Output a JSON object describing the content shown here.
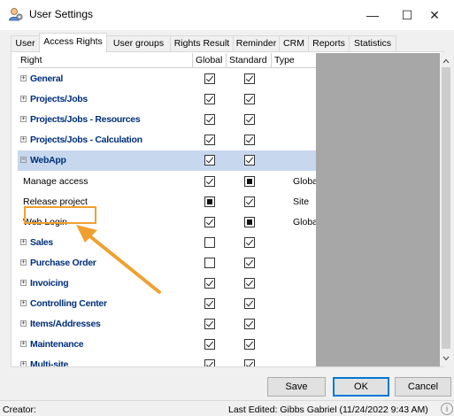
{
  "window": {
    "title": "User Settings",
    "minimize": "—",
    "maximize": "☐",
    "close": "✕"
  },
  "tabs": [
    {
      "label": "User"
    },
    {
      "label": "Access Rights",
      "active": true
    },
    {
      "label": "User groups"
    },
    {
      "label": "Rights Result"
    },
    {
      "label": "Reminder"
    },
    {
      "label": "CRM"
    },
    {
      "label": "Reports"
    },
    {
      "label": "Statistics"
    }
  ],
  "grid": {
    "columns": {
      "right": "Right",
      "global": "Global",
      "standard": "Standard",
      "type": "Type"
    },
    "rows": [
      {
        "label": "General",
        "kind": "group",
        "expander": "+",
        "global": "checked",
        "standard": "checked",
        "type": ""
      },
      {
        "label": "Projects/Jobs",
        "kind": "group",
        "expander": "+",
        "global": "checked",
        "standard": "checked",
        "type": ""
      },
      {
        "label": "Projects/Jobs - Resources",
        "kind": "group",
        "expander": "+",
        "global": "checked",
        "standard": "checked",
        "type": ""
      },
      {
        "label": "Projects/Jobs - Calculation",
        "kind": "group",
        "expander": "+",
        "global": "checked",
        "standard": "checked",
        "type": ""
      },
      {
        "label": "WebApp",
        "kind": "group",
        "expander": "−",
        "selected": true,
        "global": "checked",
        "standard": "checked",
        "type": ""
      },
      {
        "label": "Manage access",
        "kind": "child",
        "global": "checked",
        "standard": "indeterminate",
        "type": "Global"
      },
      {
        "label": "Release project",
        "kind": "child",
        "global": "indeterminate",
        "standard": "checked",
        "type": "Site"
      },
      {
        "label": "Web Login",
        "kind": "child",
        "global": "checked",
        "standard": "indeterminate",
        "type": "Global"
      },
      {
        "label": "Sales",
        "kind": "group",
        "expander": "+",
        "global": "unchecked",
        "standard": "checked",
        "type": ""
      },
      {
        "label": "Purchase Order",
        "kind": "group",
        "expander": "+",
        "global": "unchecked",
        "standard": "checked",
        "type": ""
      },
      {
        "label": "Invoicing",
        "kind": "group",
        "expander": "+",
        "global": "checked",
        "standard": "checked",
        "type": ""
      },
      {
        "label": "Controlling Center",
        "kind": "group",
        "expander": "+",
        "global": "checked",
        "standard": "checked",
        "type": ""
      },
      {
        "label": "Items/Addresses",
        "kind": "group",
        "expander": "+",
        "global": "checked",
        "standard": "checked",
        "type": ""
      },
      {
        "label": "Maintenance",
        "kind": "group",
        "expander": "+",
        "global": "checked",
        "standard": "checked",
        "type": ""
      },
      {
        "label": "Multi-site",
        "kind": "group",
        "expander": "+",
        "global": "checked",
        "standard": "checked",
        "type": ""
      }
    ]
  },
  "buttons": {
    "save": "Save",
    "ok": "OK",
    "cancel": "Cancel"
  },
  "status": {
    "creator": "Creator:",
    "last_edited": "Last Edited:  Gibbs Gabriel (11/24/2022 9:43 AM)"
  },
  "colors": {
    "selected_row": "#c7d7ee",
    "group_text": "#00307a",
    "highlight": "#f0a030",
    "gray_area": "#a7a7a7"
  },
  "icons": {
    "app": "user-settings-icon",
    "scroll_up": "chevron-up-icon",
    "scroll_down": "chevron-down-icon",
    "info": "info-icon"
  }
}
